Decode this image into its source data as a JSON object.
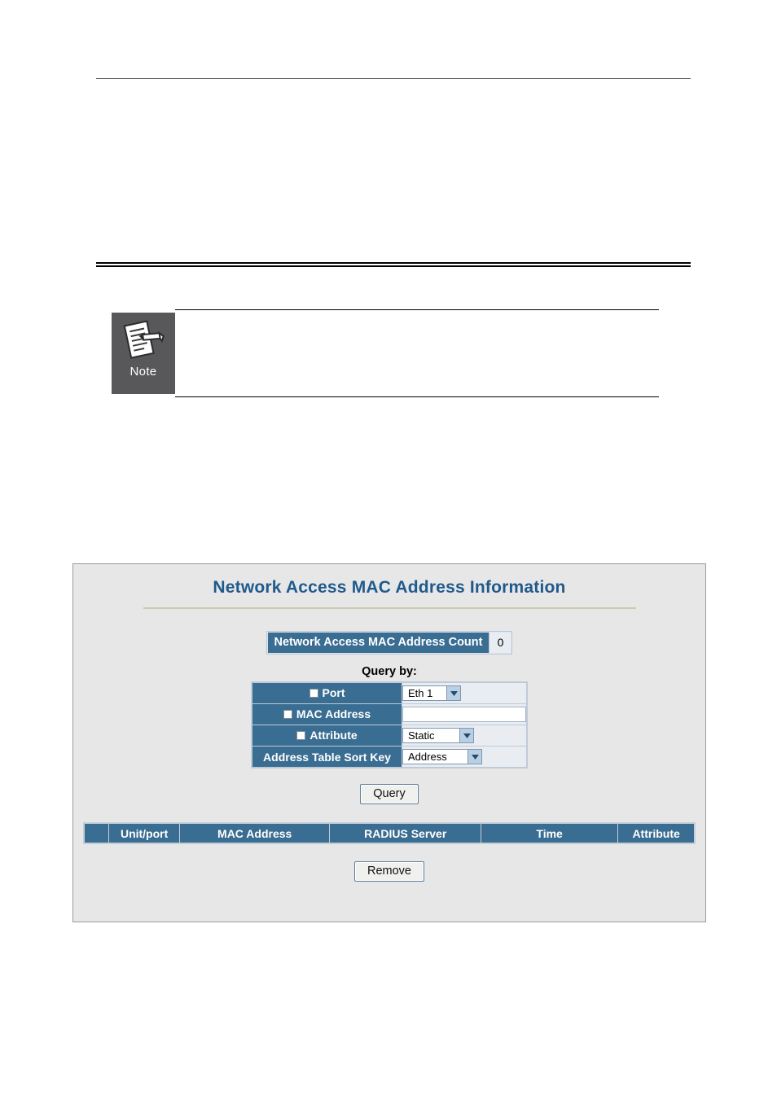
{
  "page": {
    "note": {
      "icon_label": "Note",
      "body_text": ""
    }
  },
  "panel": {
    "title": "Network Access MAC Address Information",
    "count": {
      "label": "Network Access MAC Address Count",
      "value": "0"
    },
    "query_by_label": "Query by:",
    "query_rows": [
      {
        "label": "Port",
        "has_checkbox": true,
        "control": "select",
        "value": "Eth 1"
      },
      {
        "label": "MAC Address",
        "has_checkbox": true,
        "control": "text",
        "value": "",
        "placeholder": ""
      },
      {
        "label": "Attribute",
        "has_checkbox": true,
        "control": "select",
        "value": "Static"
      },
      {
        "label": "Address Table Sort Key",
        "has_checkbox": false,
        "control": "select",
        "value": "Address"
      }
    ],
    "query_button": "Query",
    "results_headers": [
      "",
      "Unit/port",
      "MAC Address",
      "RADIUS Server",
      "Time",
      "Attribute"
    ],
    "results_rows": [],
    "remove_button": "Remove"
  },
  "colors": {
    "header_blue": "#3a6d92",
    "title_blue": "#1f5a8c",
    "panel_bg": "#e7e7e7",
    "panel_border": "#9a9a9a",
    "title_divider": "#cfc9ae",
    "note_icon_bg": "#58585b",
    "cell_bg": "#e9edf2",
    "grid_line": "#c3ced9"
  }
}
